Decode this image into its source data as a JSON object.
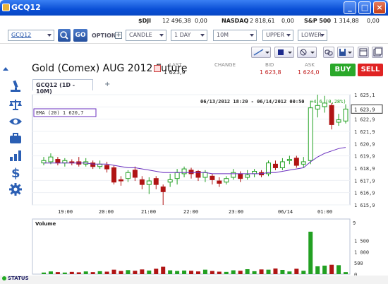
{
  "window": {
    "title": "GCQ12"
  },
  "tickers": [
    {
      "name": "$DJI",
      "value": "12 496,38",
      "change": "0,00"
    },
    {
      "name": "NASDAQ",
      "value": "2 818,61",
      "change": "0,00"
    },
    {
      "name": "S&P 500",
      "value": "1 314,88",
      "change": "0,00"
    }
  ],
  "toolbar": {
    "symbol": "GCQ12",
    "go_label": "GO",
    "option_label": "OPTION",
    "chart_type": "CANDLE",
    "period": "1 DAY",
    "interval": "10M",
    "upper": "UPPER",
    "lower": "LOWER"
  },
  "instrument": {
    "name": "Gold (Comex) AUG 2012 Future",
    "last_label": "LAST",
    "last": "1 623,9",
    "change_label": "CHANGE",
    "change": "",
    "bid_label": "BID",
    "bid": "1 623,8",
    "ask_label": "ASK",
    "ask": "1 624,0",
    "buy_label": "BUY",
    "sell_label": "SELL"
  },
  "chart_tab": {
    "label": "GCQ12 (1D - 10M)",
    "add": "+"
  },
  "colors": {
    "up": "#22a022",
    "down": "#b01414",
    "ema": "#6a2fbf",
    "accent": "#1d4fa8"
  },
  "chart_data": {
    "type": "candlestick",
    "range_label": "06/13/2012 18:20 - 06/14/2012 00:50",
    "change_label": "+4,6 (0,28%)",
    "ema_label": "EMA (20) 1 620,7",
    "last_label": "1 623,9",
    "x_ticks": [
      "19:00",
      "20:00",
      "21:00",
      "22:00",
      "23:00",
      "06/14",
      "01:00"
    ],
    "y_ticks": [
      "1 625,1",
      "1 624,0",
      "1 622,9",
      "1 621,9",
      "1 620,9",
      "1 619,9",
      "1 618,9",
      "1 617,9",
      "1 616,9",
      "1 615,9"
    ],
    "ylim": [
      1615.9,
      1625.1
    ],
    "candles": [
      [
        1619.4,
        1619.6,
        1619.9,
        1619.2
      ],
      [
        1619.5,
        1619.9,
        1620.2,
        1619.3
      ],
      [
        1619.7,
        1619.4,
        1619.9,
        1619.2
      ],
      [
        1619.4,
        1619.6,
        1619.8,
        1619.1
      ],
      [
        1619.5,
        1619.4,
        1619.7,
        1619.2
      ],
      [
        1619.5,
        1619.3,
        1619.9,
        1619.1
      ],
      [
        1619.3,
        1619.5,
        1619.8,
        1619.1
      ],
      [
        1619.4,
        1619.1,
        1619.6,
        1618.9
      ],
      [
        1619.1,
        1619.3,
        1619.6,
        1618.9
      ],
      [
        1619.2,
        1618.9,
        1619.5,
        1618.6
      ],
      [
        1619.0,
        1617.8,
        1619.2,
        1617.6
      ],
      [
        1618.0,
        1617.9,
        1618.3,
        1617.5
      ],
      [
        1618.1,
        1618.6,
        1618.8,
        1617.8
      ],
      [
        1618.8,
        1618.2,
        1619.1,
        1617.9
      ],
      [
        1618.0,
        1617.6,
        1618.3,
        1617.2
      ],
      [
        1617.6,
        1617.9,
        1618.2,
        1616.8
      ],
      [
        1618.1,
        1617.6,
        1618.3,
        1617.2
      ],
      [
        1617.4,
        1617.0,
        1617.6,
        1615.9
      ],
      [
        1617.8,
        1618.0,
        1618.5,
        1617.4
      ],
      [
        1618.1,
        1618.6,
        1618.9,
        1617.6
      ],
      [
        1618.5,
        1618.9,
        1619.1,
        1618.2
      ],
      [
        1618.8,
        1618.5,
        1619.0,
        1618.1
      ],
      [
        1618.7,
        1618.2,
        1618.8,
        1617.9
      ],
      [
        1618.2,
        1618.6,
        1618.8,
        1617.8
      ],
      [
        1618.3,
        1618.0,
        1618.5,
        1617.6
      ],
      [
        1617.9,
        1617.7,
        1618.2,
        1617.4
      ],
      [
        1617.8,
        1618.1,
        1618.3,
        1617.6
      ],
      [
        1618.2,
        1618.6,
        1618.9,
        1618.0
      ],
      [
        1618.5,
        1618.1,
        1618.7,
        1617.8
      ],
      [
        1618.2,
        1618.4,
        1618.8,
        1618.0
      ],
      [
        1618.5,
        1618.7,
        1618.9,
        1618.2
      ],
      [
        1618.6,
        1618.4,
        1618.8,
        1618.2
      ],
      [
        1618.5,
        1619.4,
        1619.6,
        1618.3
      ],
      [
        1619.3,
        1619.0,
        1619.6,
        1618.8
      ],
      [
        1619.0,
        1619.5,
        1619.8,
        1618.8
      ],
      [
        1619.6,
        1619.7,
        1620.0,
        1619.3
      ],
      [
        1619.8,
        1619.2,
        1620.0,
        1619.0
      ],
      [
        1619.3,
        1619.5,
        1619.9,
        1619.0
      ],
      [
        1619.6,
        1624.0,
        1624.6,
        1619.3
      ],
      [
        1623.9,
        1624.2,
        1625.1,
        1623.2
      ],
      [
        1624.1,
        1624.4,
        1625.0,
        1623.6
      ],
      [
        1624.2,
        1622.6,
        1624.4,
        1622.2
      ],
      [
        1622.8,
        1623.0,
        1623.5,
        1622.5
      ],
      [
        1622.9,
        1623.9,
        1624.3,
        1622.7
      ]
    ],
    "ema": [
      1619.4,
      1619.4,
      1619.4,
      1619.4,
      1619.4,
      1619.4,
      1619.4,
      1619.3,
      1619.3,
      1619.3,
      1619.2,
      1619.1,
      1619.0,
      1619.0,
      1618.9,
      1618.8,
      1618.7,
      1618.6,
      1618.6,
      1618.6,
      1618.6,
      1618.6,
      1618.6,
      1618.6,
      1618.5,
      1618.5,
      1618.5,
      1618.5,
      1618.5,
      1618.5,
      1618.5,
      1618.5,
      1618.6,
      1618.6,
      1618.7,
      1618.8,
      1618.9,
      1619.0,
      1619.5,
      1619.9,
      1620.2,
      1620.4,
      1620.6,
      1620.7
    ],
    "volume_label": "Volume",
    "volume_ticks": [
      "1 500",
      "1 000",
      "500",
      "0"
    ],
    "volume_top_label": "9",
    "volume_ylim": [
      0,
      1500
    ],
    "volume": [
      70,
      120,
      90,
      70,
      100,
      80,
      120,
      90,
      130,
      110,
      200,
      140,
      180,
      150,
      210,
      160,
      240,
      330,
      170,
      140,
      160,
      150,
      120,
      200,
      140,
      110,
      100,
      170,
      150,
      220,
      130,
      210,
      200,
      250,
      190,
      120,
      240,
      150,
      1900,
      350,
      380,
      420,
      400,
      90
    ]
  },
  "sidebar": {
    "items": [
      "collapse-icon",
      "microscope-icon",
      "scales-icon",
      "eye-icon",
      "briefcase-icon",
      "bar-chart-icon",
      "dollar-icon",
      "gear-icon"
    ]
  },
  "status": {
    "label": "STATUS"
  }
}
